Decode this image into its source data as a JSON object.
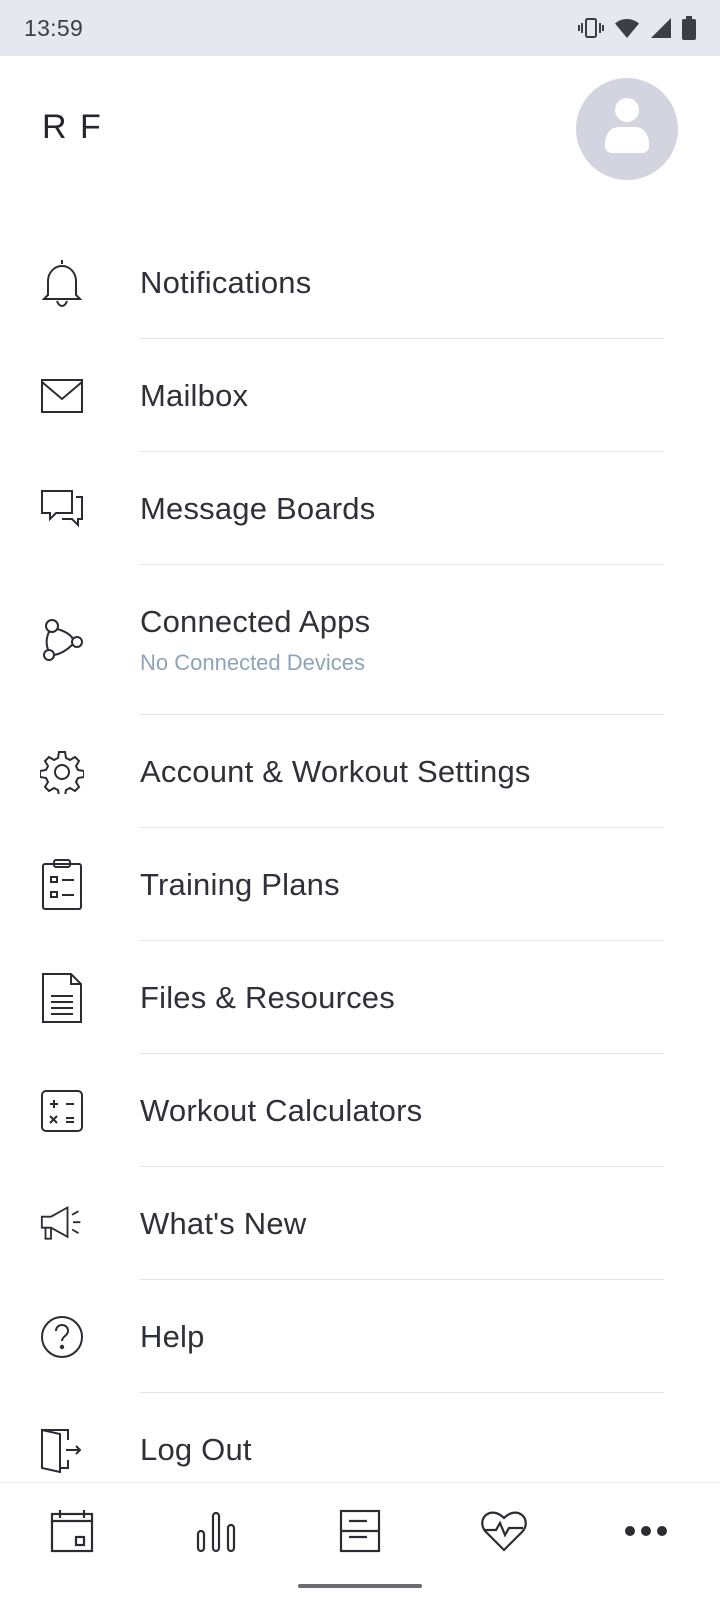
{
  "status_bar": {
    "time": "13:59",
    "icons": [
      "vibrate-icon",
      "wifi-icon",
      "signal-icon",
      "battery-icon"
    ]
  },
  "profile": {
    "initials": "R F",
    "avatar_icon": "user-avatar-icon"
  },
  "menu": {
    "items": [
      {
        "label": "Notifications",
        "icon": "bell-icon"
      },
      {
        "label": "Mailbox",
        "icon": "envelope-icon"
      },
      {
        "label": "Message Boards",
        "icon": "chat-bubbles-icon"
      },
      {
        "label": "Connected Apps",
        "sublabel": "No Connected Devices",
        "icon": "connected-nodes-icon"
      },
      {
        "label": "Account & Workout Settings",
        "icon": "gear-icon"
      },
      {
        "label": "Training Plans",
        "icon": "clipboard-list-icon"
      },
      {
        "label": "Files & Resources",
        "icon": "document-icon"
      },
      {
        "label": "Workout Calculators",
        "icon": "calculator-icon"
      },
      {
        "label": "What's New",
        "icon": "megaphone-icon"
      },
      {
        "label": "Help",
        "icon": "help-circle-icon"
      },
      {
        "label": "Log Out",
        "icon": "logout-door-icon"
      }
    ]
  },
  "bottom_nav": {
    "items": [
      {
        "icon": "calendar-icon"
      },
      {
        "icon": "bar-chart-icon"
      },
      {
        "icon": "list-card-icon"
      },
      {
        "icon": "heart-pulse-icon"
      },
      {
        "icon": "more-dots-icon"
      }
    ]
  },
  "colors": {
    "status_bar_bg": "#e6e8ef",
    "avatar_bg": "#d3d4e0",
    "sublabel": "#8fa3b8",
    "text": "#303038"
  }
}
